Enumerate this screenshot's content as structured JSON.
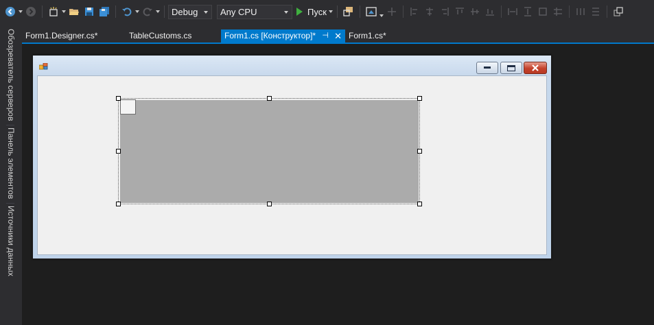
{
  "toolbar": {
    "configuration": "Debug",
    "platform": "Any CPU",
    "run_label": "Пуск",
    "icons": [
      "back-icon",
      "forward-icon",
      "new-project-icon",
      "open-file-icon",
      "save-icon",
      "save-all-icon",
      "undo-icon",
      "redo-icon",
      "run-icon",
      "find-icon",
      "screen-icon"
    ]
  },
  "side_panel": {
    "tabs": [
      "Обозреватель серверов",
      "Панель элементов",
      "Источники данных"
    ]
  },
  "document_tabs": [
    {
      "label": "Form1.Designer.cs*",
      "active": false
    },
    {
      "label": "TableCustoms.cs",
      "active": false
    },
    {
      "label": "Form1.cs [Конструктор]*",
      "active": true
    },
    {
      "label": "Form1.cs*",
      "active": false
    }
  ],
  "colors": {
    "accent": "#007acc",
    "toolbar_bg": "#2d2d30",
    "editor_bg": "#1e1e1e",
    "form_client": "#f0f0f0",
    "control_fill": "#ababab",
    "run_green": "#3fb03f"
  }
}
